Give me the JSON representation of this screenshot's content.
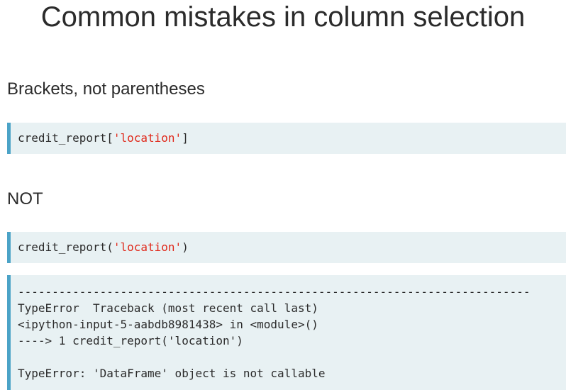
{
  "title": "Common mistakes in column selection",
  "sections": {
    "brackets_heading": "Brackets, not parentheses",
    "not_heading": "NOT"
  },
  "code_correct": {
    "prefix": "credit_report[",
    "string": "'location'",
    "suffix": "]"
  },
  "code_wrong": {
    "prefix": "credit_report(",
    "string": "'location'",
    "suffix": ")"
  },
  "error_output": {
    "separator": "---------------------------------------------------------------------------",
    "line1": "TypeError  Traceback (most recent call last)",
    "line2": "<ipython-input-5-aabdb8981438> in <module>()",
    "line3": "----> 1 credit_report('location')",
    "line4": "TypeError: 'DataFrame' object is not callable"
  },
  "colors": {
    "code_background": "#e8f1f3",
    "code_border": "#4ba3c7",
    "string_literal": "#e0291b"
  }
}
